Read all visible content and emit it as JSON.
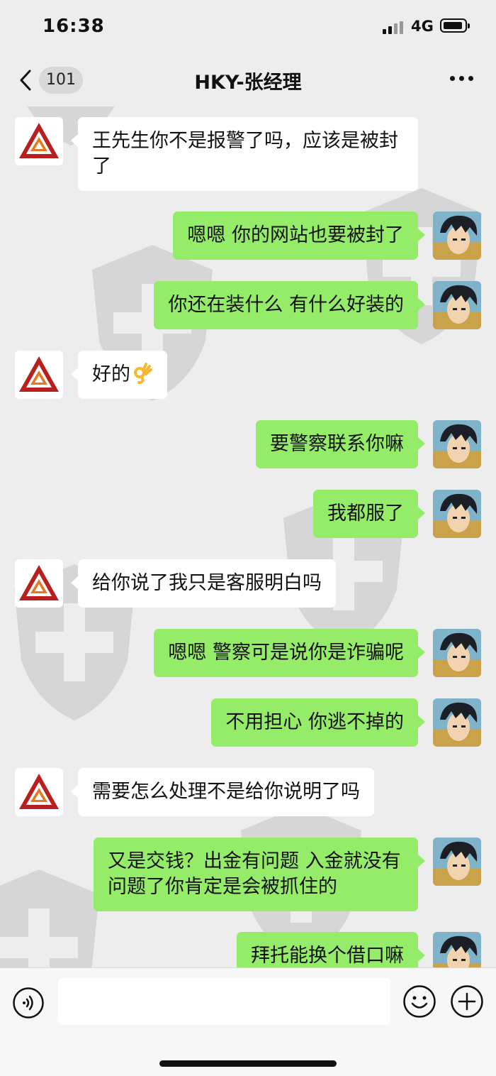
{
  "status_bar": {
    "time": "16:38",
    "network": "4G"
  },
  "nav": {
    "unread_count": "101",
    "title": "HKY-张经理"
  },
  "messages": [
    {
      "side": "left",
      "text": "王先生你不是报警了吗，应该是被封了"
    },
    {
      "side": "right",
      "text": "嗯嗯 你的网站也要被封了"
    },
    {
      "side": "right",
      "text": "你还在装什么 有什么好装的"
    },
    {
      "side": "left",
      "text": "好的",
      "emoji": "ok-hand-emoji"
    },
    {
      "side": "right",
      "text": "要警察联系你嘛"
    },
    {
      "side": "right",
      "text": "我都服了"
    },
    {
      "side": "left",
      "text": "给你说了我只是客服明白吗"
    },
    {
      "side": "right",
      "text": "嗯嗯 警察可是说你是诈骗呢"
    },
    {
      "side": "right",
      "text": "不用担心 你逃不掉的"
    },
    {
      "side": "left",
      "text": "需要怎么处理不是给你说明了吗"
    },
    {
      "side": "right",
      "text": "又是交钱？出金有问题 入金就没有问题了你肯定是会被抓住的"
    },
    {
      "side": "right",
      "text": "拜托能换个借口嘛"
    }
  ],
  "input": {
    "placeholder": ""
  },
  "colors": {
    "background": "#ededed",
    "bubble_self": "#95ec69",
    "bubble_other": "#ffffff"
  }
}
